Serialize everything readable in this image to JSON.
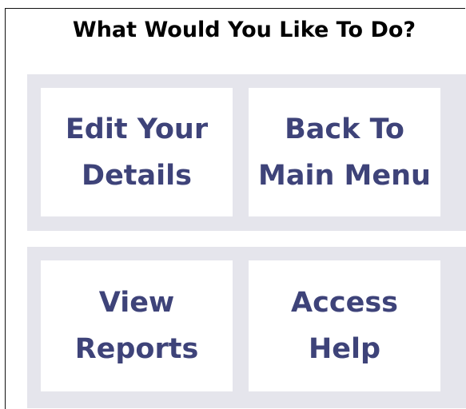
{
  "title": "What Would You Like To Do?",
  "tiles": {
    "edit_details": {
      "line1": "Edit Your",
      "line2": "Details"
    },
    "main_menu": {
      "line1": "Back To",
      "line2": "Main Menu"
    },
    "view_reports": {
      "line1": "View",
      "line2": "Reports"
    },
    "access_help": {
      "line1": "Access",
      "line2": "Help"
    }
  },
  "colors": {
    "tile_text": "#3e4379",
    "panel_background": "#e5e5ec",
    "tile_background": "#ffffff",
    "title_text": "#000000"
  }
}
